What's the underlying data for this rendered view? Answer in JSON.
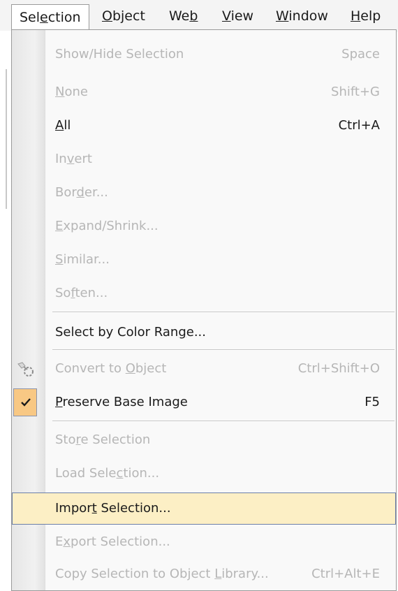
{
  "menubar": {
    "items": [
      {
        "pre": "Sel",
        "ul": "e",
        "post": "ction"
      },
      {
        "pre": "",
        "ul": "O",
        "post": "bject"
      },
      {
        "pre": "We",
        "ul": "b",
        "post": ""
      },
      {
        "pre": "",
        "ul": "V",
        "post": "iew"
      },
      {
        "pre": "",
        "ul": "W",
        "post": "indow"
      },
      {
        "pre": "",
        "ul": "H",
        "post": "elp"
      }
    ]
  },
  "menu": {
    "items": [
      {
        "pre": "Show/Hide Selection",
        "ul": "",
        "post": "",
        "shortcut": "Space"
      },
      {
        "pre": "",
        "ul": "N",
        "post": "one",
        "shortcut": "Shift+G"
      },
      {
        "pre": "",
        "ul": "A",
        "post": "ll",
        "shortcut": "Ctrl+A"
      },
      {
        "pre": "In",
        "ul": "v",
        "post": "ert",
        "shortcut": ""
      },
      {
        "pre": "Bor",
        "ul": "d",
        "post": "er...",
        "shortcut": ""
      },
      {
        "pre": "",
        "ul": "E",
        "post": "xpand/Shrink...",
        "shortcut": ""
      },
      {
        "pre": "",
        "ul": "S",
        "post": "imilar...",
        "shortcut": ""
      },
      {
        "pre": "So",
        "ul": "f",
        "post": "ten...",
        "shortcut": ""
      },
      {
        "pre": "Select by Color Ran",
        "ul": "g",
        "post": "e...",
        "shortcut": ""
      },
      {
        "pre": "Convert to ",
        "ul": "O",
        "post": "bject",
        "shortcut": "Ctrl+Shift+O"
      },
      {
        "pre": "",
        "ul": "P",
        "post": "reserve Base Image",
        "shortcut": "F5"
      },
      {
        "pre": "Sto",
        "ul": "r",
        "post": "e Selection",
        "shortcut": ""
      },
      {
        "pre": "Load Sele",
        "ul": "c",
        "post": "tion...",
        "shortcut": ""
      },
      {
        "pre": "Impor",
        "ul": "t",
        "post": " Selection...",
        "shortcut": ""
      },
      {
        "pre": "E",
        "ul": "x",
        "post": "port Selection...",
        "shortcut": ""
      },
      {
        "pre": "Copy Selection to Object ",
        "ul": "L",
        "post": "ibrary...",
        "shortcut": "Ctrl+Alt+E"
      }
    ]
  },
  "icons": {
    "checkmark": "checkmark-icon",
    "convert_to_object": "convert-to-object-icon"
  },
  "colors": {
    "highlight": "#fcefc5",
    "check_background": "#f8c884",
    "disabled_text": "#b6b6b6"
  }
}
